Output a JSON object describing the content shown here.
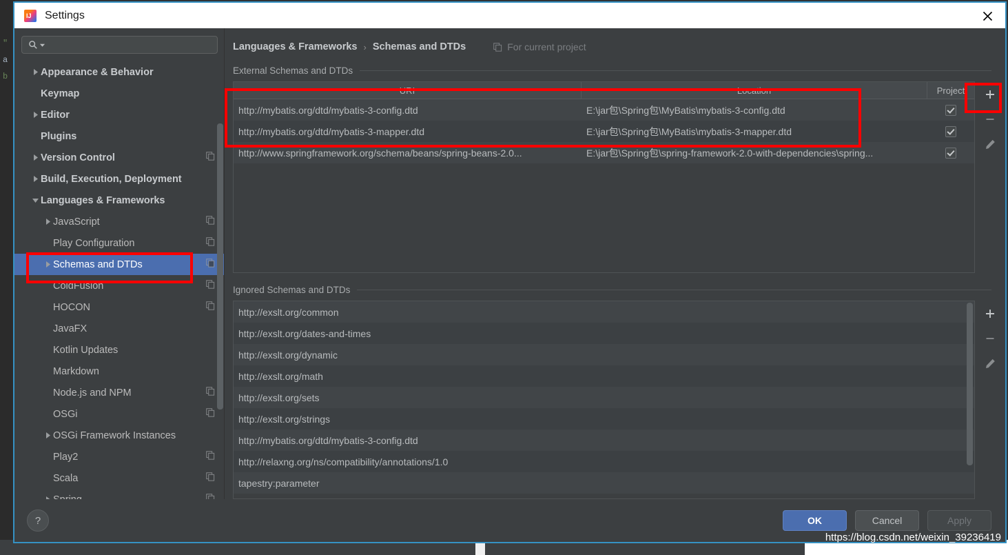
{
  "window": {
    "title": "Settings",
    "app_icon": "intellij-idea-icon",
    "close_icon": "close-icon"
  },
  "sidebar": {
    "search": {
      "placeholder": "",
      "value": "",
      "icon": "search-icon",
      "dropdown_icon": "chevron-down-icon"
    },
    "items": [
      {
        "label": "Appearance & Behavior",
        "level": 0,
        "arrow": "collapsed",
        "copy": false,
        "selected": false
      },
      {
        "label": "Keymap",
        "level": 0,
        "arrow": "none",
        "copy": false,
        "selected": false
      },
      {
        "label": "Editor",
        "level": 0,
        "arrow": "collapsed",
        "copy": false,
        "selected": false
      },
      {
        "label": "Plugins",
        "level": 0,
        "arrow": "none",
        "copy": false,
        "selected": false
      },
      {
        "label": "Version Control",
        "level": 0,
        "arrow": "collapsed",
        "copy": true,
        "selected": false
      },
      {
        "label": "Build, Execution, Deployment",
        "level": 0,
        "arrow": "collapsed",
        "copy": false,
        "selected": false
      },
      {
        "label": "Languages & Frameworks",
        "level": 0,
        "arrow": "expanded",
        "copy": false,
        "selected": false
      },
      {
        "label": "JavaScript",
        "level": 1,
        "arrow": "collapsed",
        "copy": true,
        "selected": false
      },
      {
        "label": "Play Configuration",
        "level": 1,
        "arrow": "none",
        "copy": true,
        "selected": false
      },
      {
        "label": "Schemas and DTDs",
        "level": 1,
        "arrow": "collapsed",
        "copy": true,
        "selected": true
      },
      {
        "label": "ColdFusion",
        "level": 1,
        "arrow": "none",
        "copy": true,
        "selected": false
      },
      {
        "label": "HOCON",
        "level": 1,
        "arrow": "none",
        "copy": true,
        "selected": false
      },
      {
        "label": "JavaFX",
        "level": 1,
        "arrow": "none",
        "copy": false,
        "selected": false
      },
      {
        "label": "Kotlin Updates",
        "level": 1,
        "arrow": "none",
        "copy": false,
        "selected": false
      },
      {
        "label": "Markdown",
        "level": 1,
        "arrow": "none",
        "copy": false,
        "selected": false
      },
      {
        "label": "Node.js and NPM",
        "level": 1,
        "arrow": "none",
        "copy": true,
        "selected": false
      },
      {
        "label": "OSGi",
        "level": 1,
        "arrow": "none",
        "copy": true,
        "selected": false
      },
      {
        "label": "OSGi Framework Instances",
        "level": 1,
        "arrow": "collapsed",
        "copy": false,
        "selected": false
      },
      {
        "label": "Play2",
        "level": 1,
        "arrow": "none",
        "copy": true,
        "selected": false
      },
      {
        "label": "Scala",
        "level": 1,
        "arrow": "none",
        "copy": true,
        "selected": false
      },
      {
        "label": "Spring",
        "level": 1,
        "arrow": "collapsed",
        "copy": true,
        "selected": false
      }
    ]
  },
  "main": {
    "breadcrumb": {
      "parent": "Languages & Frameworks",
      "separator": "›",
      "current": "Schemas and DTDs"
    },
    "for_current_project": {
      "label": "For current project",
      "icon": "copy-icon"
    },
    "external_section": {
      "label": "External Schemas and DTDs",
      "columns": [
        "URI",
        "Location",
        "Project"
      ],
      "rows": [
        {
          "uri": "http://mybatis.org/dtd/mybatis-3-config.dtd",
          "location": "E:\\jar包\\Spring包\\MyBatis\\mybatis-3-config.dtd",
          "project": true
        },
        {
          "uri": "http://mybatis.org/dtd/mybatis-3-mapper.dtd",
          "location": "E:\\jar包\\Spring包\\MyBatis\\mybatis-3-mapper.dtd",
          "project": true
        },
        {
          "uri": "http://www.springframework.org/schema/beans/spring-beans-2.0...",
          "location": "E:\\jar包\\Spring包\\spring-framework-2.0-with-dependencies\\spring...",
          "project": true
        }
      ],
      "toolbar": [
        {
          "name": "add-button",
          "glyph": "+"
        },
        {
          "name": "remove-button",
          "glyph": "−"
        },
        {
          "name": "edit-button",
          "glyph": "pencil"
        }
      ]
    },
    "ignored_section": {
      "label": "Ignored Schemas and DTDs",
      "rows": [
        "http://exslt.org/common",
        "http://exslt.org/dates-and-times",
        "http://exslt.org/dynamic",
        "http://exslt.org/math",
        "http://exslt.org/sets",
        "http://exslt.org/strings",
        "http://mybatis.org/dtd/mybatis-3-config.dtd",
        "http://relaxng.org/ns/compatibility/annotations/1.0",
        "tapestry:parameter"
      ],
      "toolbar": [
        {
          "name": "add-button",
          "glyph": "+"
        },
        {
          "name": "remove-button",
          "glyph": "−"
        },
        {
          "name": "edit-button",
          "glyph": "pencil"
        }
      ]
    }
  },
  "footer": {
    "help_label": "?",
    "ok_label": "OK",
    "cancel_label": "Cancel",
    "apply_label": "Apply"
  },
  "watermark": "https://blog.csdn.net/weixin_39236419",
  "colors": {
    "accent": "#4b6eaf",
    "annotation": "#fe0000",
    "dialog_bg": "#3c3f41",
    "title_bar_bg": "#ffffff",
    "border": "#3592c4"
  }
}
